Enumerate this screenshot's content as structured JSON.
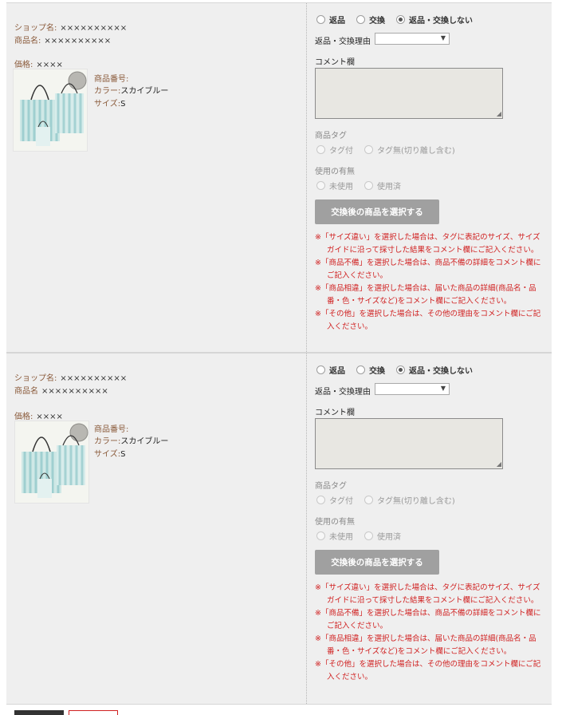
{
  "items": [
    {
      "shop_label": "ショップ名:",
      "shop_value": "××××××××××",
      "product_name_label": "商品名:",
      "product_name_value": "××××××××××",
      "price_label": "価格:",
      "price_value": "××××",
      "product_number_label": "商品番号:",
      "product_number_value": "",
      "color_label": "カラー:",
      "color_value": "スカイブルー",
      "size_label": "サイズ:",
      "size_value": "S",
      "action_options": [
        {
          "label": "返品",
          "checked": false
        },
        {
          "label": "交換",
          "checked": false
        },
        {
          "label": "返品・交換しない",
          "checked": true
        }
      ],
      "reason_label": "返品・交換理由",
      "reason_value": "",
      "comment_label": "コメント欄",
      "comment_value": "",
      "tag_label": "商品タグ",
      "tag_options": [
        {
          "label": "タグ付",
          "checked": false
        },
        {
          "label": "タグ無(切り離し含む)",
          "checked": false
        }
      ],
      "usage_label": "使用の有無",
      "usage_options": [
        {
          "label": "未使用",
          "checked": false
        },
        {
          "label": "使用済",
          "checked": false
        }
      ],
      "select_button_label": "交換後の商品を選択する",
      "notes": [
        "※「サイズ違い」を選択した場合は、タグに表記のサイズ、サイズガイドに沿って採寸した結果をコメント欄にご記入ください。",
        "※「商品不備」を選択した場合は、商品不備の詳細をコメント欄にご記入ください。",
        "※「商品相違」を選択した場合は、届いた商品の詳細(商品名・品番・色・サイズなど)をコメント欄にご記入ください。",
        "※「その他」を選択した場合は、その他の理由をコメント欄にご記入ください。"
      ]
    },
    {
      "shop_label": "ショップ名:",
      "shop_value": "××××××××××",
      "product_name_label": "商品名",
      "product_name_value": "××××××××××",
      "price_label": "価格:",
      "price_value": "××××",
      "product_number_label": "商品番号:",
      "product_number_value": "",
      "color_label": "カラー:",
      "color_value": "スカイブルー",
      "size_label": "サイズ:",
      "size_value": "S",
      "action_options": [
        {
          "label": "返品",
          "checked": false
        },
        {
          "label": "交換",
          "checked": false
        },
        {
          "label": "返品・交換しない",
          "checked": true
        }
      ],
      "reason_label": "返品・交換理由",
      "reason_value": "",
      "comment_label": "コメント欄",
      "comment_value": "",
      "tag_label": "商品タグ",
      "tag_options": [
        {
          "label": "タグ付",
          "checked": false
        },
        {
          "label": "タグ無(切り離し含む)",
          "checked": false
        }
      ],
      "usage_label": "使用の有無",
      "usage_options": [
        {
          "label": "未使用",
          "checked": false
        },
        {
          "label": "使用済",
          "checked": false
        }
      ],
      "select_button_label": "交換後の商品を選択する",
      "notes": [
        "※「サイズ違い」を選択した場合は、タグに表記のサイズ、サイズガイドに沿って採寸した結果をコメント欄にご記入ください。",
        "※「商品不備」を選択した場合は、商品不備の詳細をコメント欄にご記入ください。",
        "※「商品相違」を選択した場合は、届いた商品の詳細(商品名・品番・色・サイズなど)をコメント欄にご記入ください。",
        "※「その他」を選択した場合は、その他の理由をコメント欄にご記入ください。"
      ]
    }
  ],
  "colors": {
    "panel_bg": "#efefef",
    "note_red": "#d02020",
    "button_gray": "#a0a0a0",
    "label_brown": "#8a5a3a"
  }
}
